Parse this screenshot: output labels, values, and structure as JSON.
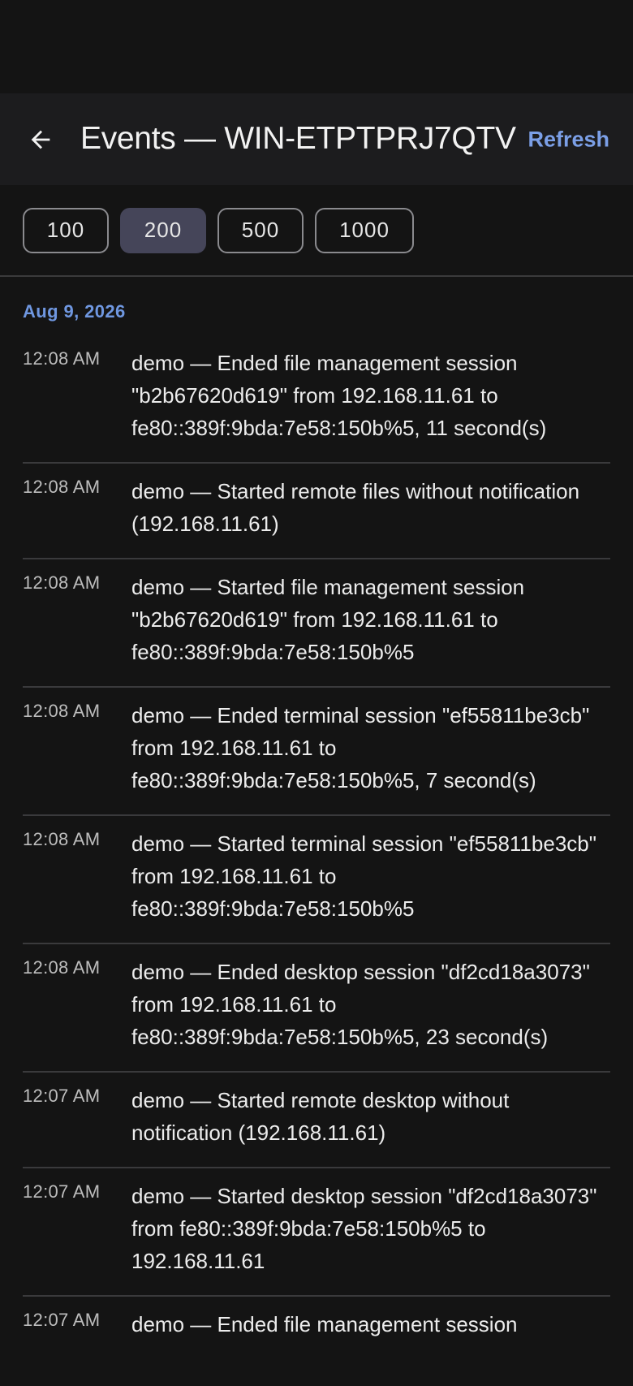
{
  "header": {
    "title": "Events — WIN-ETPTPRJ7QTV",
    "refresh_label": "Refresh",
    "back_icon": "arrow-left-icon"
  },
  "filters": {
    "options": [
      "100",
      "200",
      "500",
      "1000"
    ],
    "selected": "200"
  },
  "colors": {
    "background": "#141414",
    "app_bar": "#1c1c1e",
    "accent": "#7b9fe6",
    "selected_chip": "#454559",
    "divider": "#3a3a3c"
  },
  "events": {
    "date_header": "Aug 9, 2026",
    "items": [
      {
        "time": "12:08 AM",
        "text": "demo — Ended file management session \"b2b67620d619\" from 192.168.11.61 to fe80::389f:9bda:7e58:150b%5, 11 second(s)"
      },
      {
        "time": "12:08 AM",
        "text": "demo — Started remote files without notification (192.168.11.61)"
      },
      {
        "time": "12:08 AM",
        "text": "demo — Started file management session \"b2b67620d619\" from 192.168.11.61 to fe80::389f:9bda:7e58:150b%5"
      },
      {
        "time": "12:08 AM",
        "text": "demo — Ended terminal session \"ef55811be3cb\" from 192.168.11.61 to fe80::389f:9bda:7e58:150b%5, 7 second(s)"
      },
      {
        "time": "12:08 AM",
        "text": "demo — Started terminal session \"ef55811be3cb\" from 192.168.11.61 to fe80::389f:9bda:7e58:150b%5"
      },
      {
        "time": "12:08 AM",
        "text": "demo — Ended desktop session \"df2cd18a3073\" from 192.168.11.61 to fe80::389f:9bda:7e58:150b%5, 23 second(s)"
      },
      {
        "time": "12:07 AM",
        "text": "demo — Started remote desktop without notification (192.168.11.61)"
      },
      {
        "time": "12:07 AM",
        "text": "demo — Started desktop session \"df2cd18a3073\" from fe80::389f:9bda:7e58:150b%5 to 192.168.11.61"
      },
      {
        "time": "12:07 AM",
        "text": "demo — Ended file management session"
      }
    ]
  }
}
